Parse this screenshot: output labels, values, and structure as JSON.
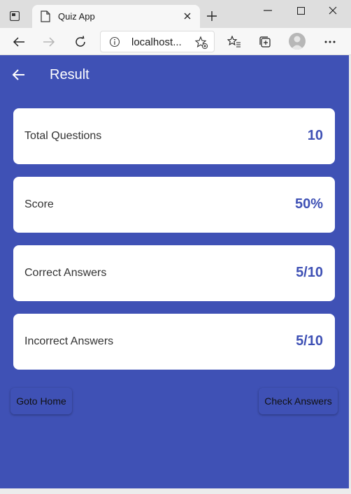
{
  "browser": {
    "tab_title": "Quiz App",
    "address_text": "localhost..."
  },
  "app": {
    "title": "Result",
    "colors": {
      "primary": "#3f51b5",
      "card": "#ffffff",
      "label": "#333333"
    },
    "stats": [
      {
        "label": "Total Questions",
        "value": "10"
      },
      {
        "label": "Score",
        "value": "50%"
      },
      {
        "label": "Correct Answers",
        "value": "5/10"
      },
      {
        "label": "Incorrect Answers",
        "value": "5/10"
      }
    ],
    "buttons": {
      "home": "Goto Home",
      "check": "Check Answers"
    }
  },
  "icons": [
    "window-menu-icon",
    "page-icon",
    "close-icon",
    "plus-icon",
    "minimize-icon",
    "maximize-icon",
    "back-arrow-icon",
    "forward-arrow-icon",
    "refresh-icon",
    "info-icon",
    "add-favorite-icon",
    "favorites-icon",
    "collections-icon",
    "profile-icon",
    "more-icon"
  ]
}
